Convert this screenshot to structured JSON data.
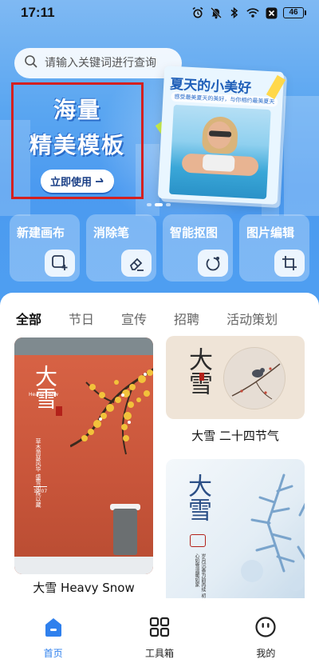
{
  "status_bar": {
    "time": "17:11",
    "battery": "46",
    "icons": [
      "alarm-icon",
      "mute-icon",
      "bluetooth-icon",
      "wifi-icon",
      "close-box-icon",
      "battery-icon"
    ]
  },
  "search": {
    "placeholder": "请输入关键词进行查询"
  },
  "banner": {
    "title_line1": "海量",
    "title_line2": "精美模板",
    "cta_label": "立即使用",
    "card_title": "夏天的小美好",
    "card_subtitle": "感受最美夏天的美好，与你相约最美夏天"
  },
  "tools": [
    {
      "label": "新建画布",
      "icon": "new-canvas-icon"
    },
    {
      "label": "消除笔",
      "icon": "eraser-icon"
    },
    {
      "label": "智能抠图",
      "icon": "smart-cutout-icon"
    },
    {
      "label": "图片编辑",
      "icon": "crop-rotate-icon"
    }
  ],
  "tabs": [
    {
      "label": "全部",
      "active": true
    },
    {
      "label": "节日",
      "active": false
    },
    {
      "label": "宣传",
      "active": false
    },
    {
      "label": "招聘",
      "active": false
    },
    {
      "label": "活动策划",
      "active": false
    }
  ],
  "templates": {
    "left": {
      "caption": "大雪 Heavy Snow",
      "title_chars": "大雪",
      "en_text": "Heavy Snow",
      "vertical_text": "草木萧瑟风华 盛雪如院以藏",
      "date": "12·07"
    },
    "right_top": {
      "caption": "大雪 二十四节气",
      "title_chars": "大雪"
    },
    "right_bottom": {
      "title_chars": "大雪",
      "vertical_text": "岁月沉香为韵再续 初心如雪温暖如家"
    }
  },
  "bottom_nav": [
    {
      "label": "首页",
      "icon": "home-icon",
      "active": true
    },
    {
      "label": "工具箱",
      "icon": "grid-icon",
      "active": false
    },
    {
      "label": "我的",
      "icon": "smiley-icon",
      "active": false
    }
  ],
  "colors": {
    "accent": "#2f80ed",
    "hero": "#4b9af0",
    "highlight_border": "#d42020"
  }
}
